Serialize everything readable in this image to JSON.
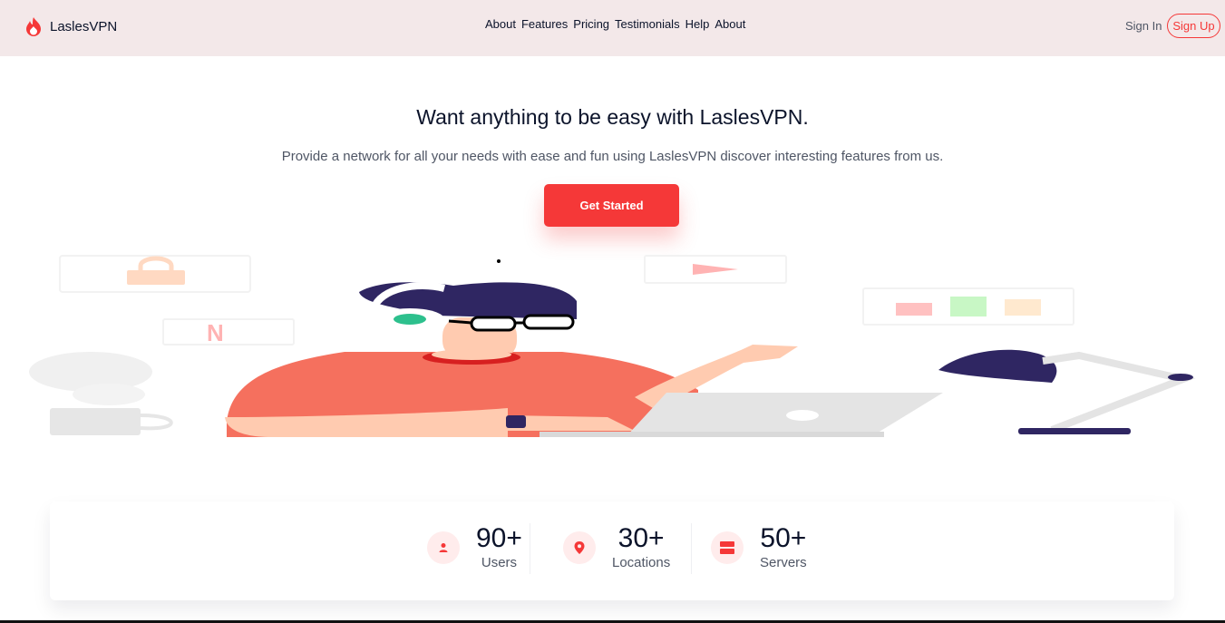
{
  "brand": {
    "name": "LaslesVPN",
    "accent": "#F53838",
    "logo_icon": "flame-icon"
  },
  "nav": {
    "items": [
      "About",
      "Features",
      "Pricing",
      "Testimonials",
      "Help",
      "About"
    ]
  },
  "auth": {
    "sign_in": "Sign In",
    "sign_up": "Sign Up"
  },
  "hero": {
    "title": "Want anything to be easy with LaslesVPN.",
    "subtitle": "Provide a network for all your needs with ease and fun using LaslesVPN discover interesting features from us.",
    "cta": "Get Started"
  },
  "stats": [
    {
      "value": "90+",
      "label": "Users",
      "icon": "user-icon"
    },
    {
      "value": "30+",
      "label": "Locations",
      "icon": "location-pin-icon"
    },
    {
      "value": "50+",
      "label": "Servers",
      "icon": "server-icon"
    }
  ]
}
